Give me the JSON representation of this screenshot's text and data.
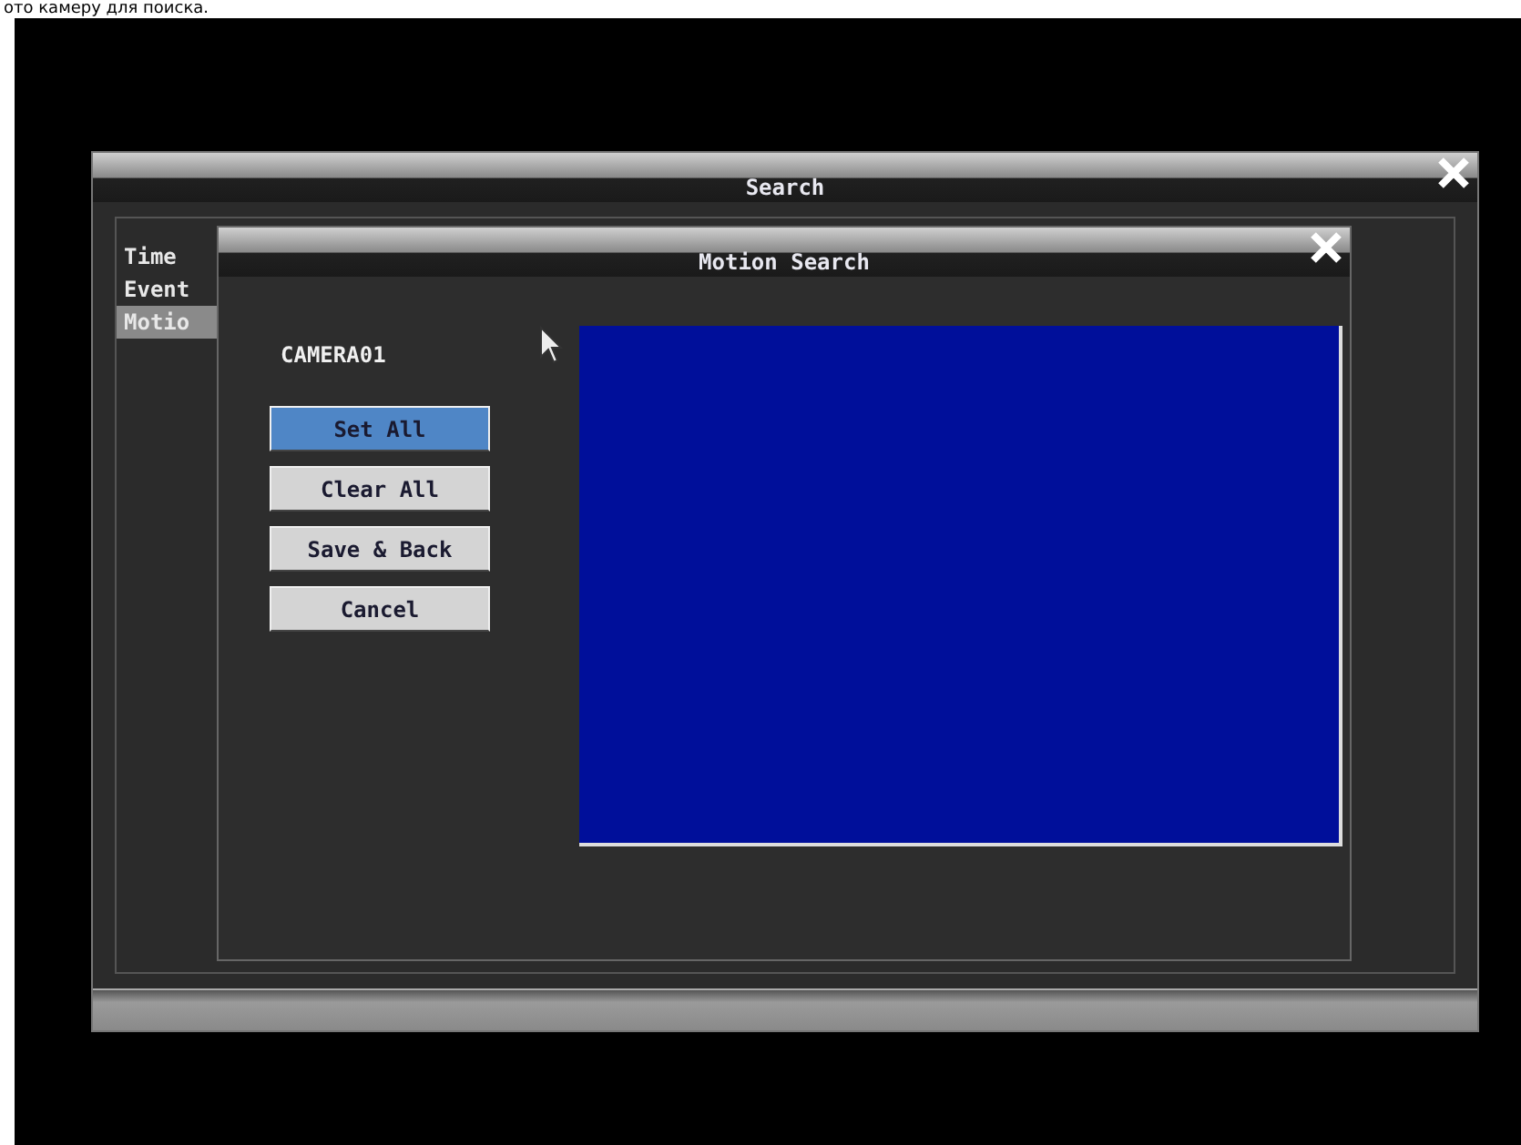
{
  "caption": "ото камеру для поиска.",
  "window": {
    "title": "Search"
  },
  "sidebar": {
    "items": [
      {
        "label": "Time",
        "selected": false
      },
      {
        "label": "Event",
        "selected": false
      },
      {
        "label": "Motio",
        "selected": true
      }
    ]
  },
  "dialog": {
    "title": "Motion Search",
    "camera": "CAMERA01",
    "buttons": [
      {
        "label": "Set All",
        "selected": true
      },
      {
        "label": "Clear All",
        "selected": false
      },
      {
        "label": "Save & Back",
        "selected": false
      },
      {
        "label": "Cancel",
        "selected": false
      }
    ]
  }
}
